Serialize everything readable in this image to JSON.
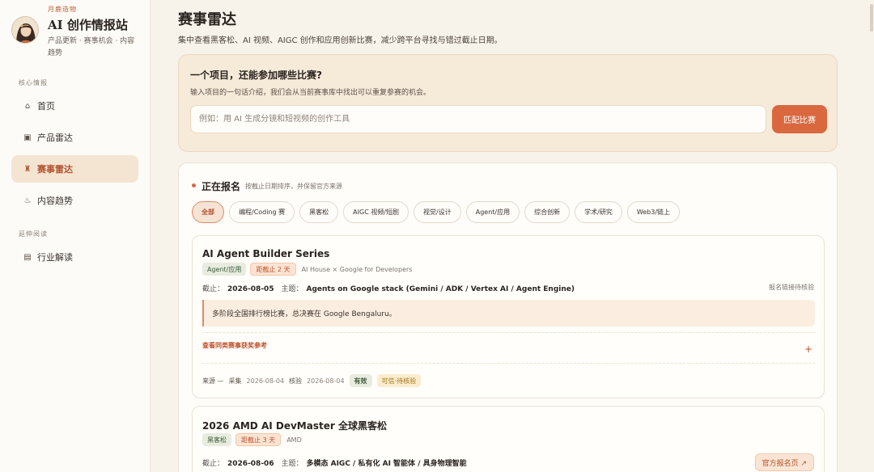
{
  "brand": {
    "tagline": "月鹿造物",
    "title": "AI 创作情报站",
    "subtitle": "产品更新 · 赛事机会 · 内容趋势"
  },
  "nav": {
    "section_core": "核心情报",
    "items": [
      {
        "label": "首页",
        "icon": "home-icon",
        "glyph": "⌂"
      },
      {
        "label": "产品雷达",
        "icon": "radar-icon",
        "glyph": "▣"
      },
      {
        "label": "赛事雷达",
        "icon": "trophy-icon",
        "glyph": "♜"
      },
      {
        "label": "内容趋势",
        "icon": "trend-icon",
        "glyph": "♨"
      }
    ],
    "section_extended": "延伸阅读",
    "extended_items": [
      {
        "label": "行业解读",
        "icon": "document-icon",
        "glyph": "▤"
      }
    ]
  },
  "page": {
    "title": "赛事雷达",
    "subtitle": "集中查看黑客松、AI 视频、AIGC 创作和应用创新比赛，减少跨平台寻找与错过截止日期。"
  },
  "matcher": {
    "title": "一个项目，还能参加哪些比赛?",
    "description": "输入项目的一句话介绍，我们会从当前赛事库中找出可以重复参赛的机会。",
    "placeholder": "例如：用 AI 生成分镜和短视频的创作工具",
    "button": "匹配比赛"
  },
  "list": {
    "title": "正在报名",
    "subtitle": "按截止日期排序，并保留官方来源",
    "filters": [
      "全部",
      "编程/Coding 赛",
      "黑客松",
      "AIGC 视频/短剧",
      "视觉/设计",
      "Agent/应用",
      "综合创新",
      "学术/研究",
      "Web3/链上"
    ],
    "active_filter": 0
  },
  "events": [
    {
      "name": "AI Agent Builder Series",
      "category": "Agent/应用",
      "deadline_badge": "距截止 2 天",
      "organizer": "AI House × Google for Developers",
      "deadline_label": "截止：",
      "deadline": "2026-08-05",
      "theme_label": "主题：",
      "theme": "Agents on Google stack (Gemini / ADK / Vertex AI / Agent Engine)",
      "status": "报名链接待核验",
      "note": "多阶段全国排行榜比赛，总决赛在 Google Bengaluru。",
      "reference_link": "查看同类赛事获奖参考",
      "source": "来源 —",
      "collected_label": "采集",
      "collected": "2026-08-04",
      "verified_label": "核验",
      "verified": "2026-08-04",
      "validity": "有效",
      "trust": "可信·待核验"
    },
    {
      "name": "2026 AMD AI DevMaster 全球黑客松",
      "category": "黑客松",
      "deadline_badge": "距截止 3 天",
      "organizer": "AMD",
      "deadline_label": "截止：",
      "deadline": "2026-08-06",
      "theme_label": "主题：",
      "theme": "多模态 AIGC / 私有化 AI 智能体 / 具身物理智能",
      "official_button": "官方报名页 ↗"
    }
  ]
}
